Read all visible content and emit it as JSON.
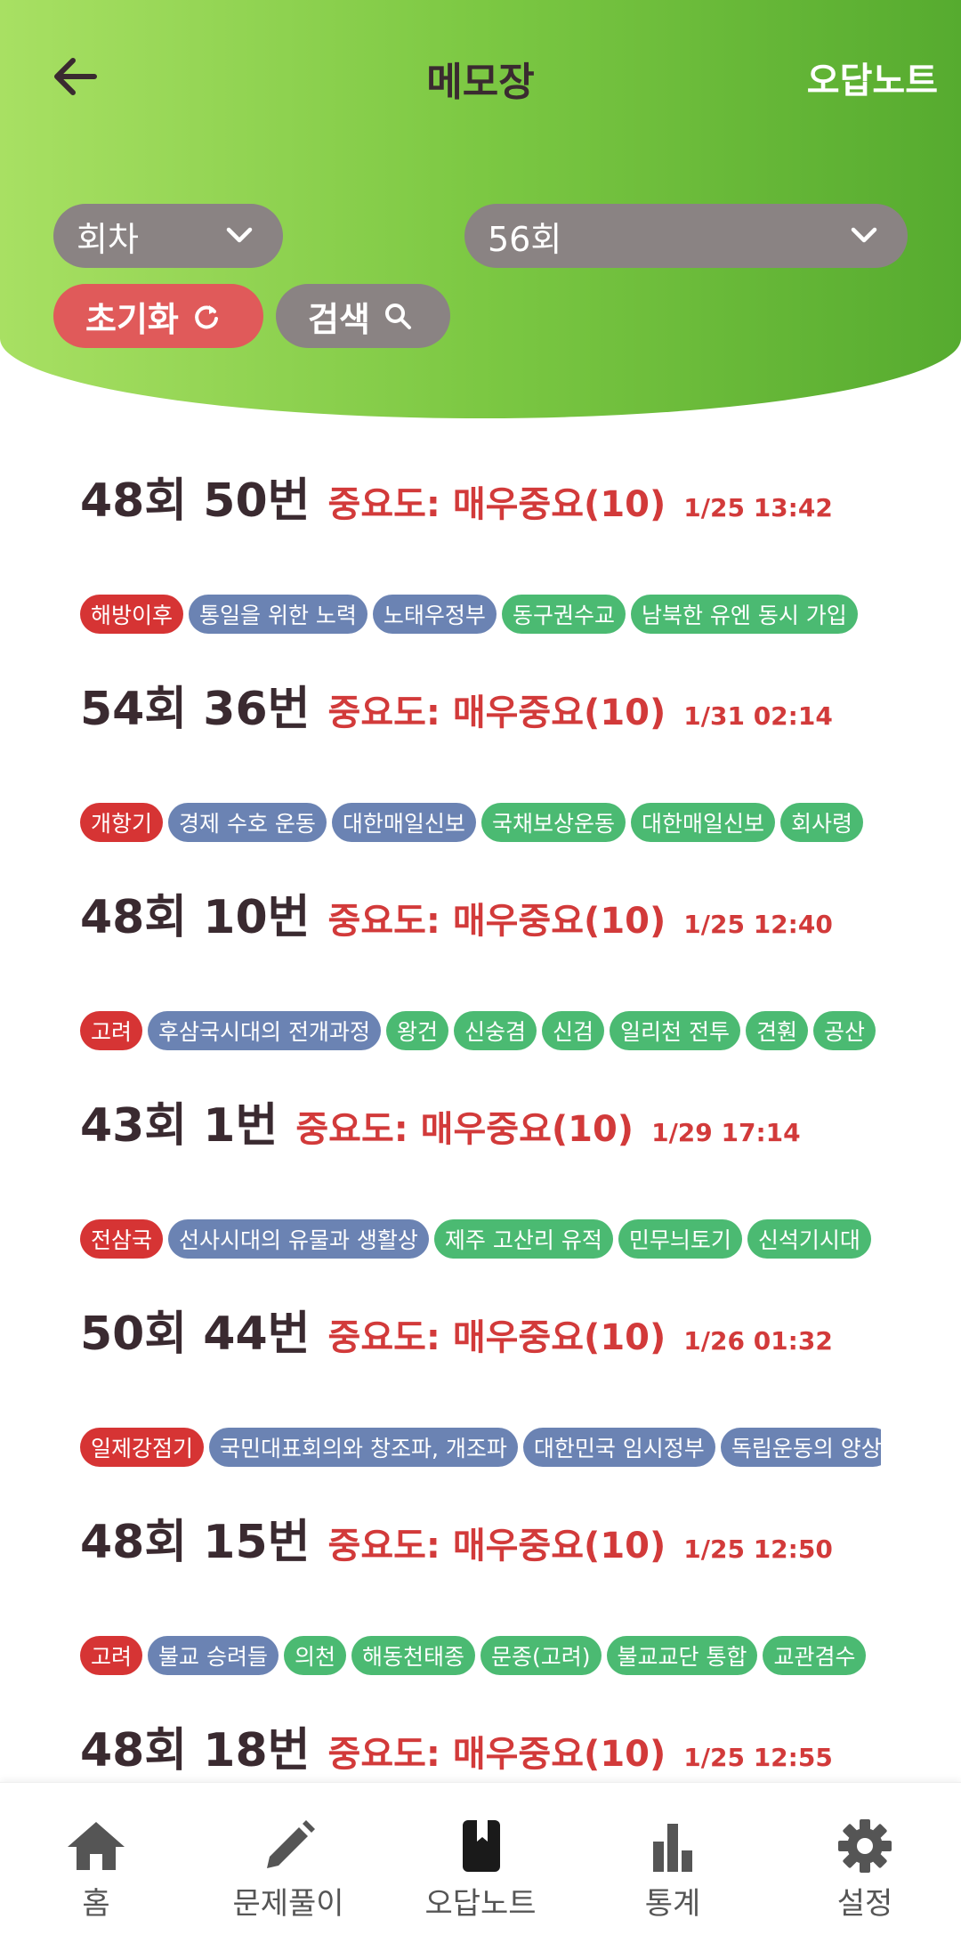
{
  "header": {
    "title": "메모장",
    "right_link": "오답노트",
    "round_select": {
      "value": "회차"
    },
    "number_select": {
      "value": "56회"
    },
    "reset_button": "초기화",
    "search_button": "검색"
  },
  "entries": [
    {
      "question": "48회 50번",
      "importance": "중요도: 매우중요(10)",
      "time": "1/25 13:42",
      "tags": [
        {
          "label": "해방이후",
          "color": "red"
        },
        {
          "label": "통일을 위한 노력",
          "color": "blue"
        },
        {
          "label": "노태우정부",
          "color": "blue"
        },
        {
          "label": "동구권수교",
          "color": "green"
        },
        {
          "label": "남북한 유엔 동시 가입",
          "color": "green"
        }
      ]
    },
    {
      "question": "54회 36번",
      "importance": "중요도: 매우중요(10)",
      "time": "1/31 02:14",
      "tags": [
        {
          "label": "개항기",
          "color": "red"
        },
        {
          "label": "경제 수호 운동",
          "color": "blue"
        },
        {
          "label": "대한매일신보",
          "color": "blue"
        },
        {
          "label": "국채보상운동",
          "color": "green"
        },
        {
          "label": "대한매일신보",
          "color": "green"
        },
        {
          "label": "회사령",
          "color": "green"
        }
      ]
    },
    {
      "question": "48회 10번",
      "importance": "중요도: 매우중요(10)",
      "time": "1/25 12:40",
      "tags": [
        {
          "label": "고려",
          "color": "red"
        },
        {
          "label": "후삼국시대의 전개과정",
          "color": "blue"
        },
        {
          "label": "왕건",
          "color": "green"
        },
        {
          "label": "신숭겸",
          "color": "green"
        },
        {
          "label": "신검",
          "color": "green"
        },
        {
          "label": "일리천 전투",
          "color": "green"
        },
        {
          "label": "견훤",
          "color": "green"
        },
        {
          "label": "공산",
          "color": "green"
        }
      ]
    },
    {
      "question": "43회 1번",
      "importance": "중요도: 매우중요(10)",
      "time": "1/29 17:14",
      "tags": [
        {
          "label": "전삼국",
          "color": "red"
        },
        {
          "label": "선사시대의 유물과 생활상",
          "color": "blue"
        },
        {
          "label": "제주 고산리 유적",
          "color": "green"
        },
        {
          "label": "민무늬토기",
          "color": "green"
        },
        {
          "label": "신석기시대",
          "color": "green"
        }
      ]
    },
    {
      "question": "50회 44번",
      "importance": "중요도: 매우중요(10)",
      "time": "1/26 01:32",
      "tags": [
        {
          "label": "일제강점기",
          "color": "red"
        },
        {
          "label": "국민대표회의와 창조파, 개조파",
          "color": "blue"
        },
        {
          "label": "대한민국 임시정부",
          "color": "blue"
        },
        {
          "label": "독립운동의 양상",
          "color": "blue"
        }
      ]
    },
    {
      "question": "48회 15번",
      "importance": "중요도: 매우중요(10)",
      "time": "1/25 12:50",
      "tags": [
        {
          "label": "고려",
          "color": "red"
        },
        {
          "label": "불교 승려들",
          "color": "blue"
        },
        {
          "label": "의천",
          "color": "green"
        },
        {
          "label": "해동천태종",
          "color": "green"
        },
        {
          "label": "문종(고려)",
          "color": "green"
        },
        {
          "label": "불교교단 통합",
          "color": "green"
        },
        {
          "label": "교관겸수",
          "color": "green"
        }
      ]
    },
    {
      "question": "48회 18번",
      "importance": "중요도: 매우중요(10)",
      "time": "1/25 12:55",
      "tags": []
    }
  ],
  "bottom_nav": [
    {
      "label": "홈",
      "icon": "home-icon"
    },
    {
      "label": "문제풀이",
      "icon": "pencil-icon"
    },
    {
      "label": "오답노트",
      "icon": "bookmark-book-icon"
    },
    {
      "label": "통계",
      "icon": "bar-chart-icon"
    },
    {
      "label": "설정",
      "icon": "gear-icon"
    }
  ],
  "colors": {
    "header_gradient_start": "#a8e063",
    "header_gradient_end": "#56ab2f",
    "importance_red": "#d23a3a",
    "tag_red": "#d63434",
    "tag_blue": "#6b83b3",
    "tag_green": "#4bba72",
    "select_grey": "#8a8383",
    "reset_red": "#e05a5a"
  }
}
